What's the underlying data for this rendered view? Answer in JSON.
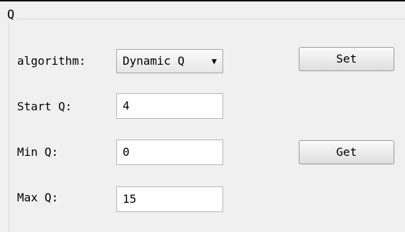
{
  "group": {
    "title": "Q"
  },
  "algorithm": {
    "label": "algorithm:",
    "selected": "Dynamic Q",
    "arrow_icon": "dropdown-arrow"
  },
  "fields": {
    "start_q": {
      "label": "Start Q:",
      "value": "4"
    },
    "min_q": {
      "label": "Min Q:",
      "value": "0"
    },
    "max_q": {
      "label": "Max Q:",
      "value": "15"
    }
  },
  "buttons": {
    "set_label": "Set",
    "get_label": "Get"
  }
}
